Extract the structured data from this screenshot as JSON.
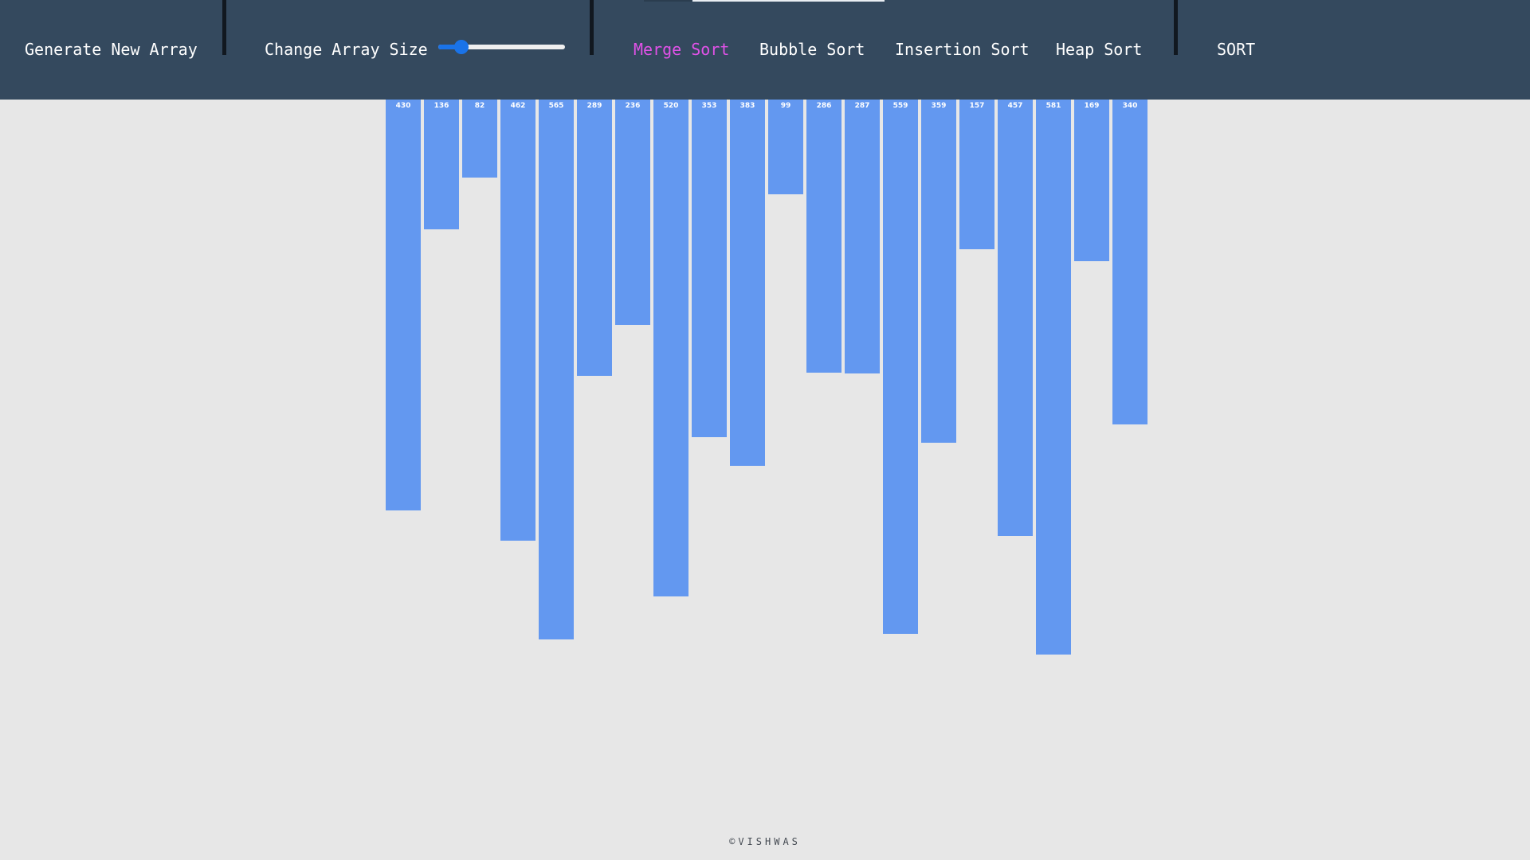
{
  "navbar": {
    "generate_label": "Generate New Array",
    "change_size_label": "Change Array Size",
    "slider": {
      "fraction": 0.18
    },
    "algorithms": [
      {
        "label": "Merge Sort",
        "active": true
      },
      {
        "label": "Bubble Sort",
        "active": false
      },
      {
        "label": "Insertion Sort",
        "active": false
      },
      {
        "label": "Heap Sort",
        "active": false
      }
    ],
    "sort_label": "SORT"
  },
  "colors": {
    "navbar_bg": "#34495e",
    "active_algorithm": "#e152e8",
    "bar": "#6398f0",
    "background": "#e7e7e7",
    "slider_accent": "#1a73e8"
  },
  "array": [
    430,
    136,
    82,
    462,
    565,
    289,
    236,
    520,
    353,
    383,
    99,
    286,
    287,
    559,
    359,
    157,
    457,
    581,
    169,
    340
  ],
  "footer": {
    "text": "©VISHWAS"
  }
}
